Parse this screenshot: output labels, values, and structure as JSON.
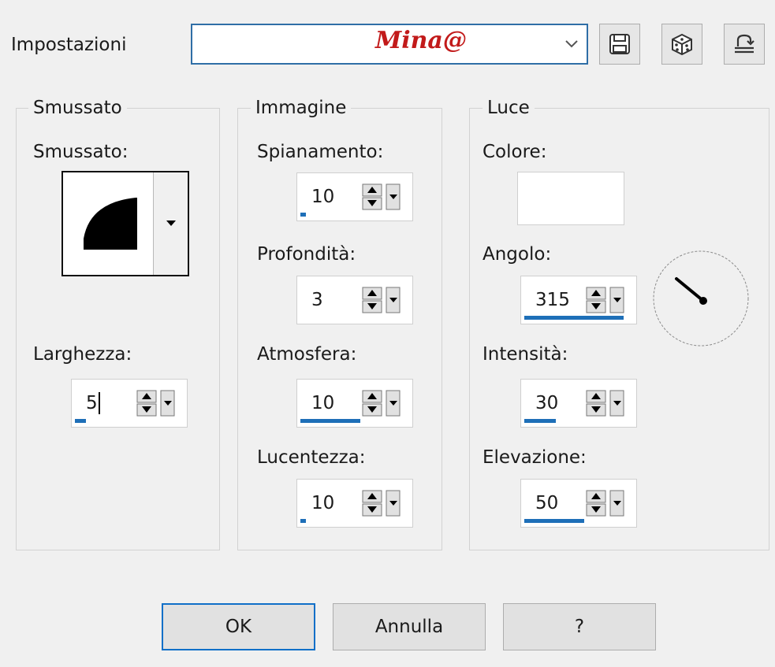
{
  "settings": {
    "label": "Impostazioni",
    "preset_value": "Mina@",
    "preset_color": "#c21a1a",
    "buttons": [
      {
        "icon": "save-icon"
      },
      {
        "icon": "dice-icon"
      },
      {
        "icon": "reset-icon"
      }
    ]
  },
  "groups": {
    "bevel": {
      "title": "Smussato",
      "bevel_label": "Smussato:",
      "width_label": "Larghezza:",
      "width_value": "5"
    },
    "image": {
      "title": "Immagine",
      "smoothness_label": "Spianamento:",
      "smoothness_value": "10",
      "depth_label": "Profondità:",
      "depth_value": "3",
      "ambience_label": "Atmosfera:",
      "ambience_value": "10",
      "shininess_label": "Lucentezza:",
      "shininess_value": "10"
    },
    "light": {
      "title": "Luce",
      "color_label": "Colore:",
      "color_value": "#ffffff",
      "angle_label": "Angolo:",
      "angle_value": "315",
      "intensity_label": "Intensità:",
      "intensity_value": "30",
      "elevation_label": "Elevazione:",
      "elevation_value": "50"
    }
  },
  "footer": {
    "ok_label": "OK",
    "cancel_label": "Annulla",
    "help_label": "?"
  },
  "accent_color": "#1e6fb8"
}
